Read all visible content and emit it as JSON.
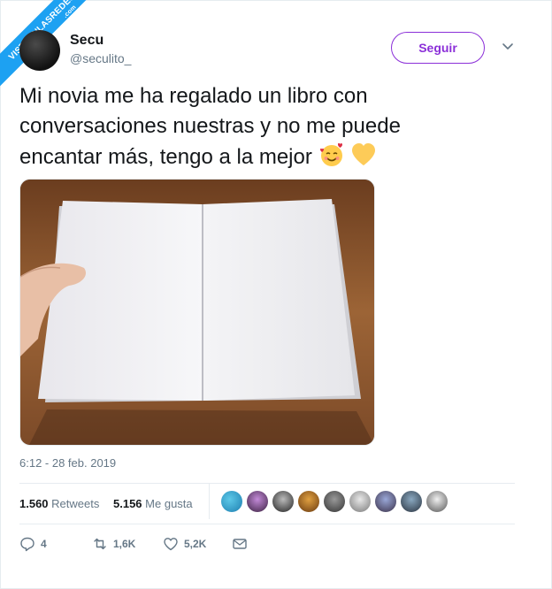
{
  "watermark": {
    "text": "VISTOENLASREDES",
    "suffix": ".com"
  },
  "user": {
    "name": "Secu",
    "handle": "@seculito_"
  },
  "follow_label": "Seguir",
  "tweet": {
    "line1": "Mi novia me ha regalado un libro con",
    "line2": "conversaciones nuestras y no me puede",
    "line3": "encantar más, tengo a la mejor"
  },
  "timestamp": "6:12 - 28 feb. 2019",
  "stats": {
    "retweets_count": "1.560",
    "retweets_label": "Retweets",
    "likes_count": "5.156",
    "likes_label": "Me gusta"
  },
  "actions": {
    "replies": "4",
    "retweets": "1,6K",
    "likes": "5,2K"
  },
  "colors": {
    "accent": "#8b2fd8",
    "twitter_blue": "#1da1f2",
    "muted": "#657786"
  },
  "icons": [
    "chevron-down-icon",
    "smiling-face-with-hearts-icon",
    "yellow-heart-icon",
    "reply-icon",
    "retweet-icon",
    "like-icon",
    "message-icon"
  ]
}
